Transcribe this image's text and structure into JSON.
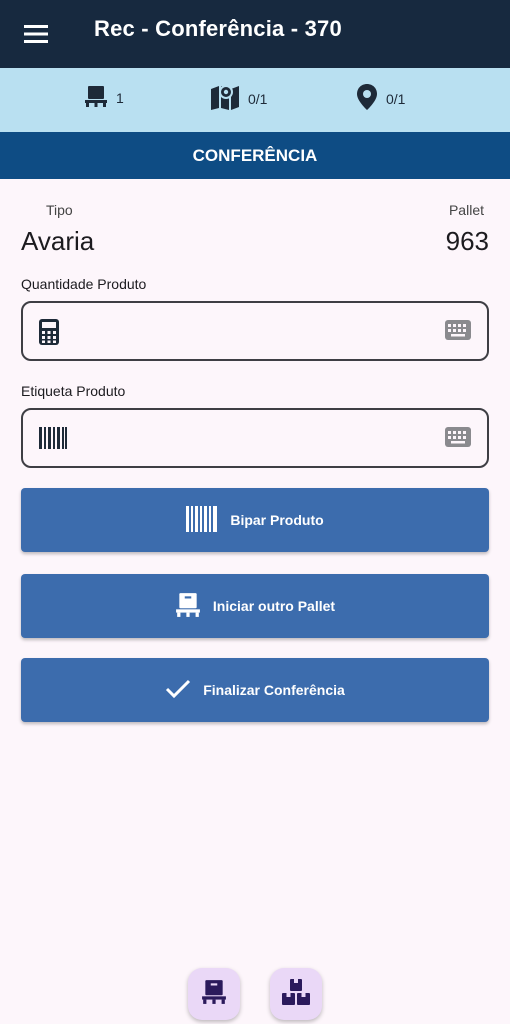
{
  "appbar": {
    "title": "Rec - Conferência - 370"
  },
  "status": {
    "pallets_count": "1",
    "map_count": "0/1",
    "location_count": "0/1"
  },
  "section": {
    "title": "CONFERÊNCIA"
  },
  "info": {
    "tipo_label": "Tipo",
    "tipo_value": "Avaria",
    "pallet_label": "Pallet",
    "pallet_value": "963"
  },
  "fields": {
    "quantidade_label": "Quantidade Produto",
    "quantidade_value": "",
    "etiqueta_label": "Etiqueta Produto",
    "etiqueta_value": ""
  },
  "buttons": {
    "bipar": "Bipar Produto",
    "iniciar": "Iniciar outro Pallet",
    "finalizar": "Finalizar Conferência"
  },
  "colors": {
    "appbar": "#17293f",
    "status_bg": "#b9e0f1",
    "section_bg": "#0e4c84",
    "button_bg": "#3c6cad",
    "fab_bg": "#ead8f7"
  },
  "icons": {
    "menu": "menu-icon",
    "pallet": "pallet-icon",
    "map": "map-pin-icon",
    "location": "location-pin-icon",
    "calculator": "calculator-icon",
    "barcode": "barcode-icon",
    "keyboard": "keyboard-icon",
    "check": "check-icon",
    "boxes": "boxes-icon"
  }
}
